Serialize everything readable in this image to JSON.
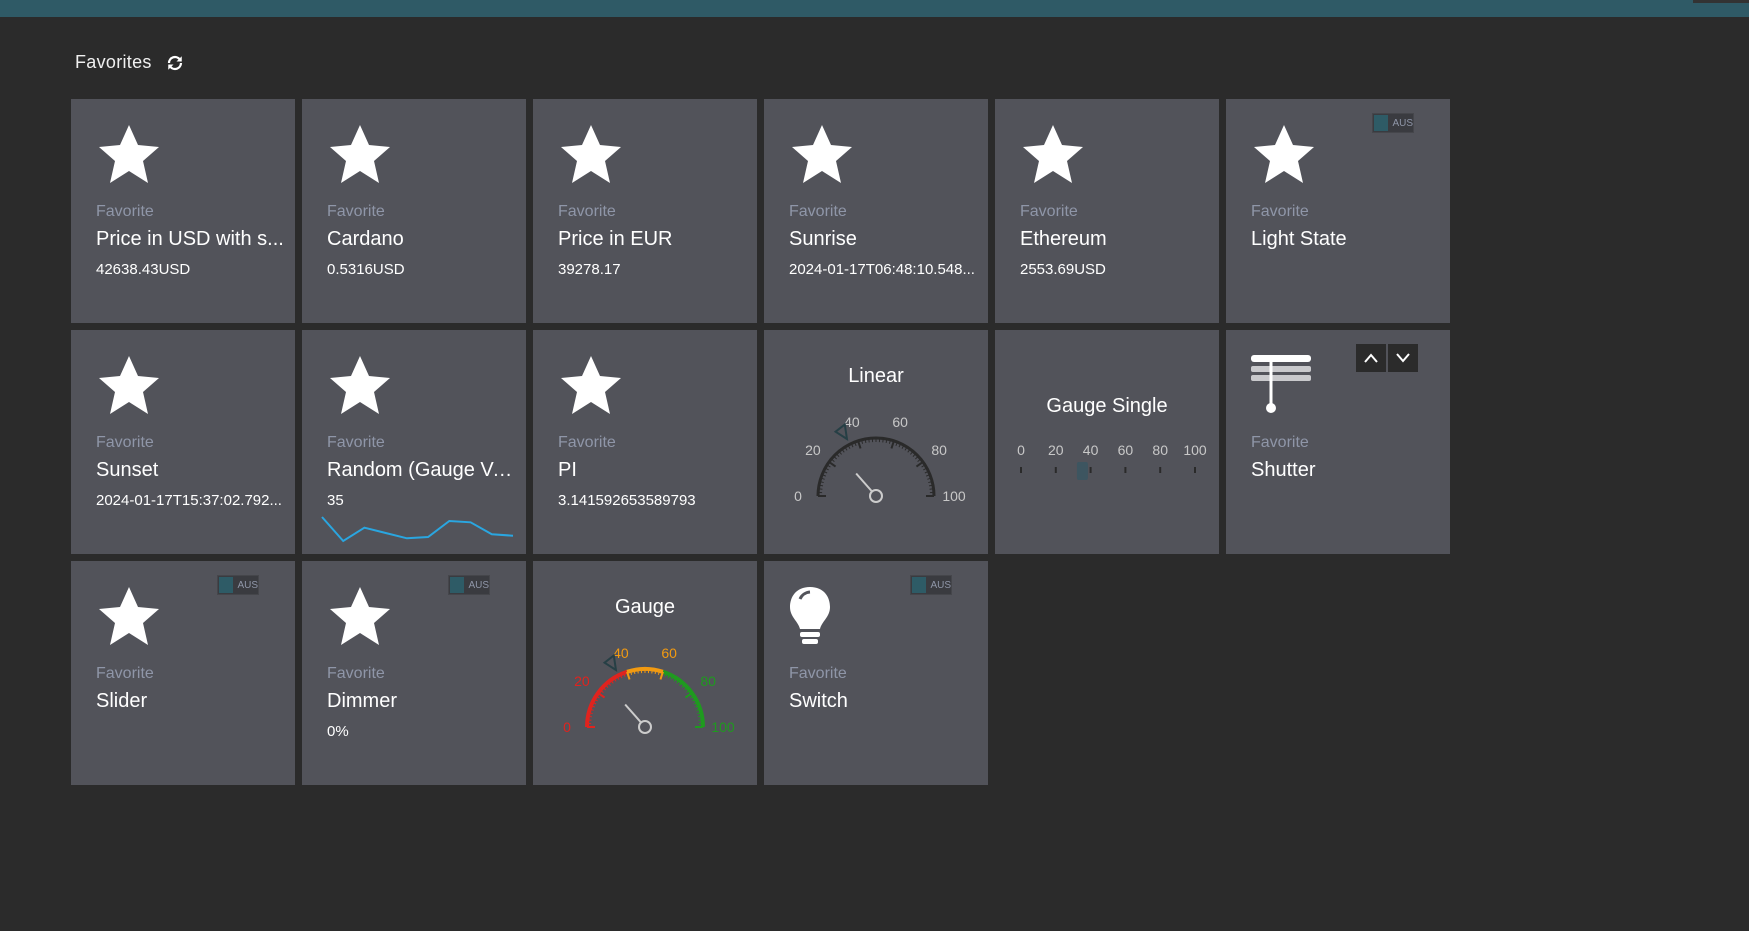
{
  "header": {
    "title": "Favorites",
    "refresh_icon": "refresh-icon"
  },
  "tiles": [
    {
      "kind": "Favorite",
      "name": "Price in USD with s...",
      "value": "42638.43USD",
      "icon": "star-icon"
    },
    {
      "kind": "Favorite",
      "name": "Cardano",
      "value": "0.5316USD",
      "icon": "star-icon"
    },
    {
      "kind": "Favorite",
      "name": "Price in EUR",
      "value": "39278.17",
      "icon": "star-icon"
    },
    {
      "kind": "Favorite",
      "name": "Sunrise",
      "value": "2024-01-17T06:48:10.548...",
      "icon": "star-icon"
    },
    {
      "kind": "Favorite",
      "name": "Ethereum",
      "value": "2553.69USD",
      "icon": "star-icon"
    },
    {
      "kind": "Favorite",
      "name": "Light State",
      "value": "",
      "icon": "star-icon",
      "toggle": "AUS"
    },
    {
      "kind": "Favorite",
      "name": "Sunset",
      "value": "2024-01-17T15:37:02.792...",
      "icon": "star-icon"
    },
    {
      "kind": "Favorite",
      "name": "Random (Gauge Va...",
      "value": "35",
      "icon": "star-icon",
      "sparkline": [
        30,
        12,
        22,
        18,
        14,
        15,
        27,
        26,
        17,
        16
      ]
    },
    {
      "kind": "Favorite",
      "name": "PI",
      "value": "3.141592653589793",
      "icon": "star-icon"
    },
    {
      "title": "Linear",
      "gauge_ticks": [
        "0",
        "20",
        "40",
        "60",
        "80",
        "100"
      ],
      "value": 35
    },
    {
      "title": "Gauge Single",
      "scale_ticks": [
        "0",
        "20",
        "40",
        "60",
        "80",
        "100"
      ],
      "value": 35
    },
    {
      "kind": "Favorite",
      "name": "Shutter",
      "icon": "shutter-icon",
      "up_icon": "chevron-up-icon",
      "down_icon": "chevron-down-icon"
    },
    {
      "kind": "Favorite",
      "name": "Slider",
      "value": "",
      "icon": "star-icon",
      "toggle": "AUS"
    },
    {
      "kind": "Favorite",
      "name": "Dimmer",
      "value": "0%",
      "icon": "star-icon",
      "toggle": "AUS"
    },
    {
      "title": "Gauge",
      "gauge_ticks": [
        "0",
        "20",
        "40",
        "60",
        "80",
        "100"
      ],
      "value": 35,
      "colors": {
        "low": "#e0231e",
        "mid": "#f29a11",
        "high": "#1f9a1f"
      }
    },
    {
      "kind": "Favorite",
      "name": "Switch",
      "value": "",
      "icon": "lightbulb-icon",
      "toggle": "AUS"
    }
  ],
  "colors": {
    "tile": "#52535a",
    "background": "#2b2b2b",
    "topbar": "#2f5a66",
    "sparkline": "#2aa6e0"
  }
}
